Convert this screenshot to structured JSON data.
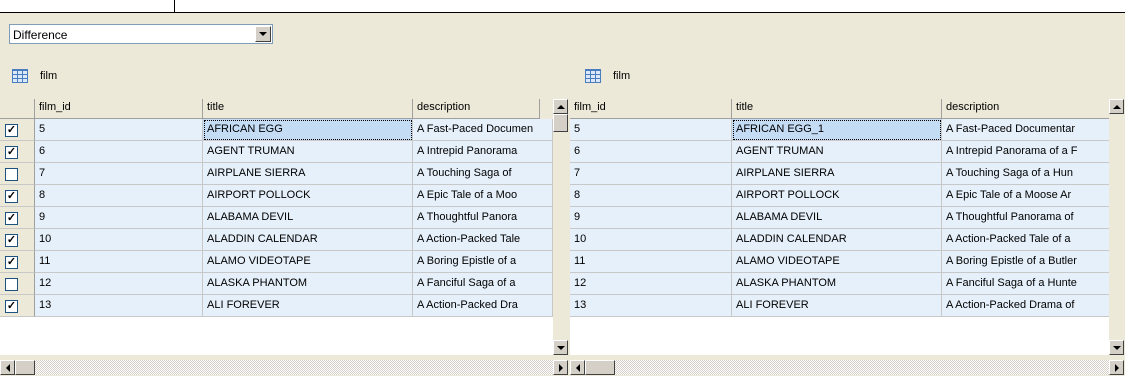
{
  "compare_mode": {
    "selected": "Difference"
  },
  "left": {
    "table_name": "film",
    "columns": [
      "film_id",
      "title",
      "description"
    ],
    "rows": [
      {
        "checked": true,
        "film_id": "5",
        "title": "AFRICAN EGG",
        "description": "A Fast-Paced Documen"
      },
      {
        "checked": true,
        "film_id": "6",
        "title": "AGENT TRUMAN",
        "description": "A Intrepid Panorama"
      },
      {
        "checked": false,
        "film_id": "7",
        "title": "AIRPLANE SIERRA",
        "description": "A Touching Saga of"
      },
      {
        "checked": true,
        "film_id": "8",
        "title": "AIRPORT POLLOCK",
        "description": "A Epic Tale of a Moo"
      },
      {
        "checked": true,
        "film_id": "9",
        "title": "ALABAMA DEVIL",
        "description": "A Thoughtful Panora"
      },
      {
        "checked": true,
        "film_id": "10",
        "title": "ALADDIN CALENDAR",
        "description": "A Action-Packed Tale"
      },
      {
        "checked": true,
        "film_id": "11",
        "title": "ALAMO VIDEOTAPE",
        "description": "A Boring Epistle of a"
      },
      {
        "checked": false,
        "film_id": "12",
        "title": "ALASKA PHANTOM",
        "description": "A Fanciful Saga of a"
      },
      {
        "checked": true,
        "film_id": "13",
        "title": "ALI FOREVER",
        "description": "A Action-Packed Dra"
      }
    ]
  },
  "right": {
    "table_name": "film",
    "columns": [
      "film_id",
      "title",
      "description"
    ],
    "rows": [
      {
        "film_id": "5",
        "title": "AFRICAN EGG_1",
        "description": "A Fast-Paced Documentar"
      },
      {
        "film_id": "6",
        "title": "AGENT TRUMAN",
        "description": "A Intrepid Panorama of a F"
      },
      {
        "film_id": "7",
        "title": "AIRPLANE SIERRA",
        "description": "A Touching Saga of a Hun"
      },
      {
        "film_id": "8",
        "title": "AIRPORT POLLOCK",
        "description": "A Epic Tale of a Moose Ar"
      },
      {
        "film_id": "9",
        "title": "ALABAMA DEVIL",
        "description": "A Thoughtful Panorama of"
      },
      {
        "film_id": "10",
        "title": "ALADDIN CALENDAR",
        "description": "A Action-Packed Tale of a"
      },
      {
        "film_id": "11",
        "title": "ALAMO VIDEOTAPE",
        "description": "A Boring Epistle of a Butler"
      },
      {
        "film_id": "12",
        "title": "ALASKA PHANTOM",
        "description": "A Fanciful Saga of a Hunte"
      },
      {
        "film_id": "13",
        "title": "ALI FOREVER",
        "description": "A Action-Packed Drama of"
      }
    ]
  },
  "icons": {
    "table": "table-icon",
    "dropdown": "chevron-down-icon"
  }
}
